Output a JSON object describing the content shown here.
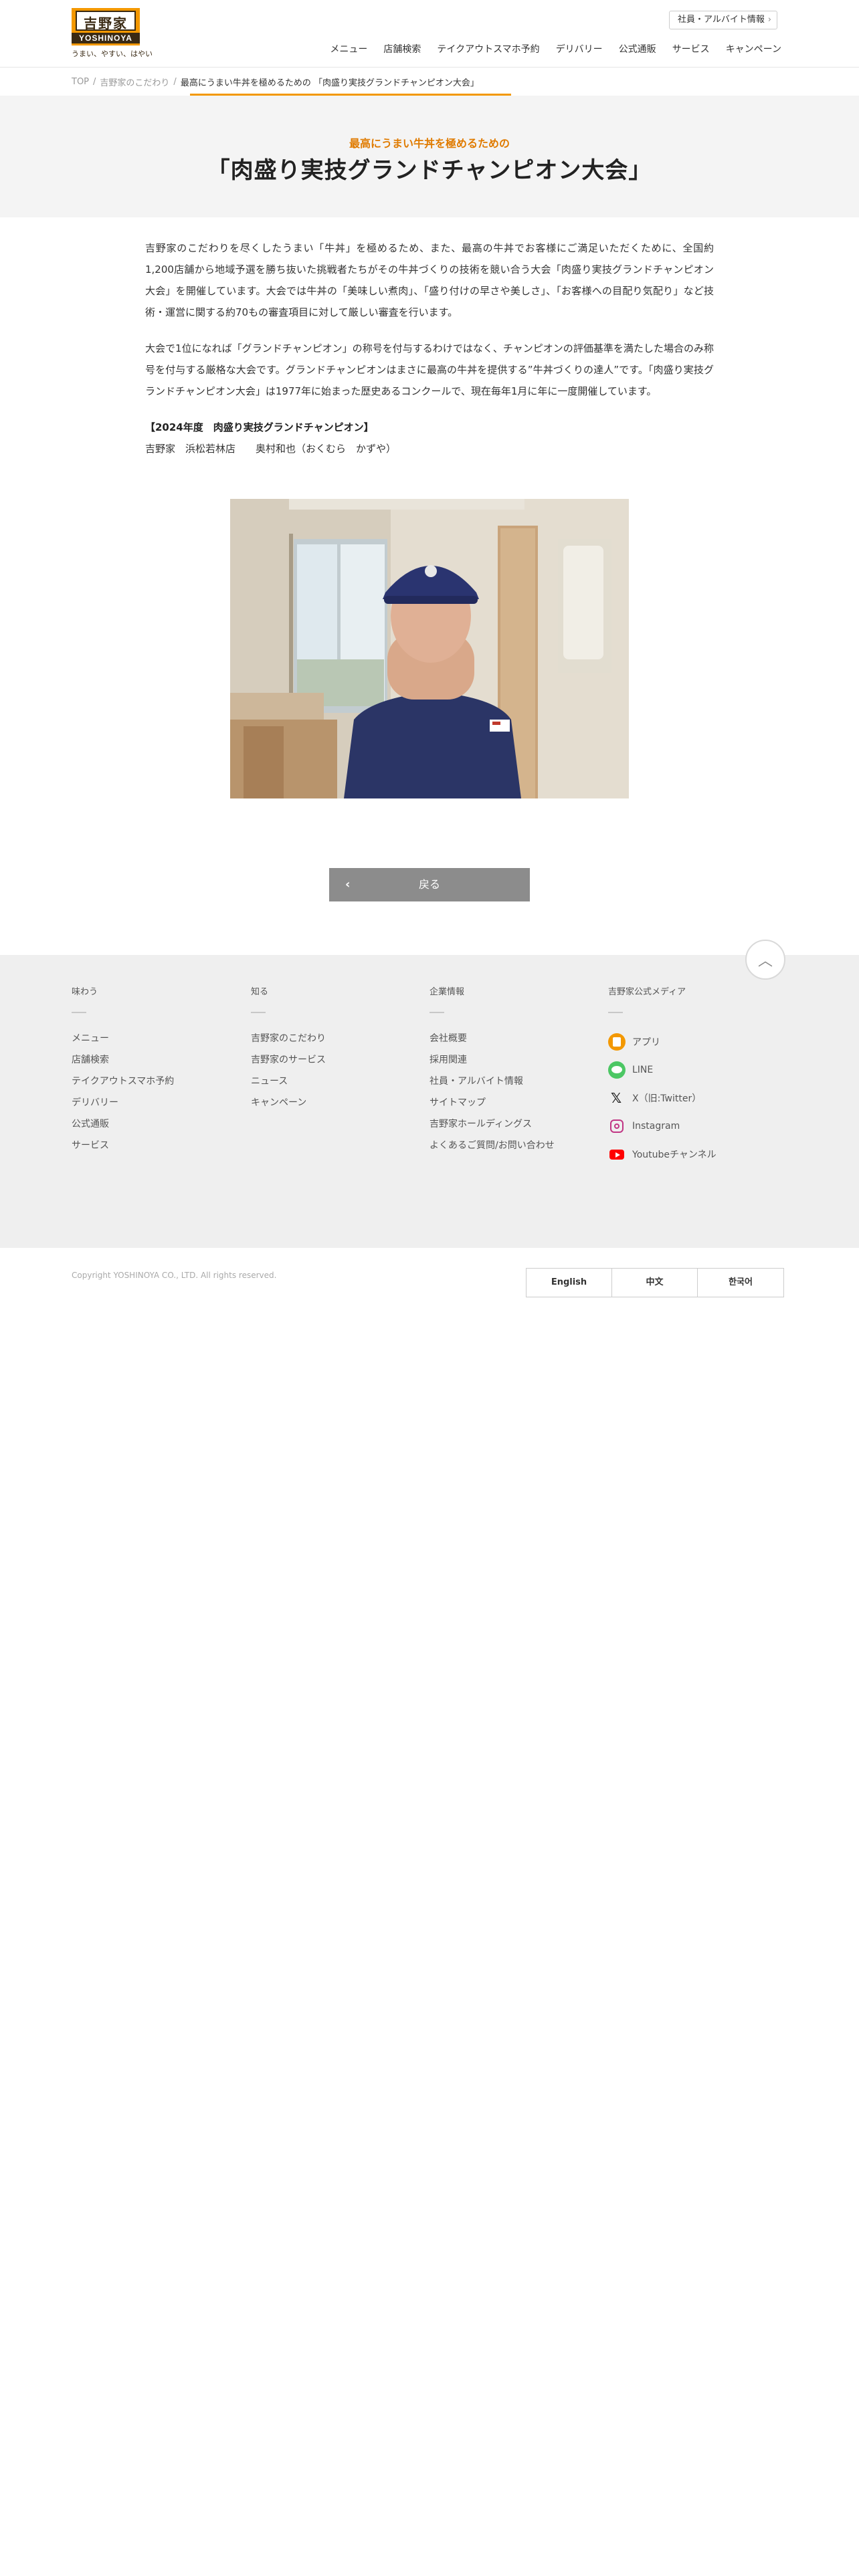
{
  "header": {
    "logo_kanji": "吉野家",
    "logo_en": "YOSHINOYA",
    "logo_tagline": "うまい、やすい、はやい",
    "recruit_label": "社員・アルバイト情報",
    "nav": [
      "メニュー",
      "店舗検索",
      "テイクアウトスマホ予約",
      "デリバリー",
      "公式通販",
      "サービス",
      "キャンペーン"
    ]
  },
  "breadcrumb": {
    "top": "TOP",
    "parent": "吉野家のこだわり",
    "current": "最高にうまい牛丼を極めるための 「肉盛り実技グランドチャンピオン大会」"
  },
  "page": {
    "subtitle": "最高にうまい牛丼を極めるための",
    "title": "「肉盛り実技グランドチャンピオン大会」"
  },
  "article": {
    "paragraph1": "吉野家のこだわりを尽くしたうまい「牛丼」を極めるため、また、最高の牛丼でお客様にご満足いただくために、全国約1,200店舗から地域予選を勝ち抜いた挑戦者たちがその牛丼づくりの技術を競い合う大会「肉盛り実技グランドチャンピオン大会」を開催しています。大会では牛丼の「美味しい煮肉」、「盛り付けの早さや美しさ」、「お客様への目配り気配り」など技術・運営に関する約70もの審査項目に対して厳しい審査を行います。",
    "paragraph2": "大会で1位になれば「グランドチャンピオン」の称号を付与するわけではなく、チャンピオンの評価基準を満たした場合のみ称号を付与する厳格な大会です。グランドチャンピオンはまさに最高の牛丼を提供する”牛丼づくりの達人”です。「肉盛り実技グランドチャンピオン大会」は1977年に始まった歴史あるコンクールで、現在毎年1月に年に一度開催しています。",
    "champion_heading": "【2024年度　肉盛り実技グランドチャンピオン】",
    "champion_name": "吉野家　浜松若林店　　奥村和也（おくむら　かずや）"
  },
  "back_label": "戻る",
  "footer": {
    "col1": {
      "heading": "味わう",
      "items": [
        "メニュー",
        "店舗検索",
        "テイクアウトスマホ予約",
        "デリバリー",
        "公式通販",
        "サービス"
      ]
    },
    "col2": {
      "heading": "知る",
      "items": [
        "吉野家のこだわり",
        "吉野家のサービス",
        "ニュース",
        "キャンペーン"
      ]
    },
    "col3": {
      "heading": "企業情報",
      "items": [
        "会社概要",
        "採用関連",
        "社員・アルバイト情報",
        "サイトマップ",
        "吉野家ホールディングス",
        "よくあるご質問/お問い合わせ"
      ]
    },
    "col4": {
      "heading": "吉野家公式メディア",
      "items": [
        "アプリ",
        "LINE",
        "X（旧:Twitter）",
        "Instagram",
        "Youtubeチャンネル"
      ]
    },
    "copyright": "Copyright YOSHINOYA CO., LTD. All rights reserved.",
    "languages": [
      "English",
      "中文",
      "한국어"
    ]
  },
  "colors": {
    "accent": "#f39800",
    "title_orange": "#e07b00",
    "back_button": "#8c8c8c",
    "footer_bg": "#efefef"
  }
}
